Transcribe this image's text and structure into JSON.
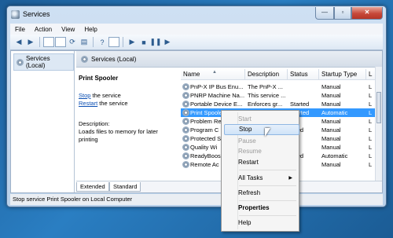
{
  "window": {
    "title": "Services"
  },
  "caption": {
    "min": "—",
    "max": "▫",
    "close": "✕"
  },
  "menu": [
    "File",
    "Action",
    "View",
    "Help"
  ],
  "tree": {
    "item": "Services (Local)"
  },
  "main": {
    "header": "Services (Local)"
  },
  "detail": {
    "name": "Print Spooler",
    "stop_link": "Stop",
    "stop_rest": " the service",
    "restart_link": "Restart",
    "restart_rest": " the service",
    "desc_label": "Description:",
    "desc_text": "Loads files to memory for later printing"
  },
  "columns": {
    "name": "Name",
    "description": "Description",
    "status": "Status",
    "startup": "Startup Type",
    "logon": "L"
  },
  "rows": [
    {
      "name": "PnP-X IP Bus Enu...",
      "description": "The PnP-X ...",
      "status": "",
      "startup": "Manual",
      "logon": "L"
    },
    {
      "name": "PNRP Machine Na...",
      "description": "This service ...",
      "status": "",
      "startup": "Manual",
      "logon": "L"
    },
    {
      "name": "Portable Device E...",
      "description": "Enforces gr...",
      "status": "Started",
      "startup": "Manual",
      "logon": "L"
    },
    {
      "name": "Print Spooler",
      "description": "Loads files t",
      "status": "Started",
      "startup": "Automatic",
      "logon": "L"
    },
    {
      "name": "Problem Re",
      "description": "",
      "status": "",
      "startup": "Manual",
      "logon": "L"
    },
    {
      "name": "Program C",
      "description": "",
      "status": "arted",
      "startup": "Manual",
      "logon": "L"
    },
    {
      "name": "Protected S",
      "description": "",
      "status": "",
      "startup": "Manual",
      "logon": "L"
    },
    {
      "name": "Quality Wi",
      "description": "",
      "status": "",
      "startup": "Manual",
      "logon": "L"
    },
    {
      "name": "ReadyBoos",
      "description": "",
      "status": "arted",
      "startup": "Automatic",
      "logon": "L"
    },
    {
      "name": "Remote Ac",
      "description": "",
      "status": "",
      "startup": "Manual",
      "logon": "L"
    }
  ],
  "tabs": [
    "Extended",
    "Standard"
  ],
  "status_bar": "Stop service Print Spooler on Local Computer",
  "context_menu": {
    "start": "Start",
    "stop": "Stop",
    "pause": "Pause",
    "resume": "Resume",
    "restart": "Restart",
    "all_tasks": "All Tasks",
    "refresh": "Refresh",
    "properties": "Properties",
    "help": "Help",
    "submenu_arrow": "▶"
  },
  "colors": {
    "selection": "#3399ff",
    "link": "#0b4fb3",
    "desktop": "#2a7ec2"
  }
}
